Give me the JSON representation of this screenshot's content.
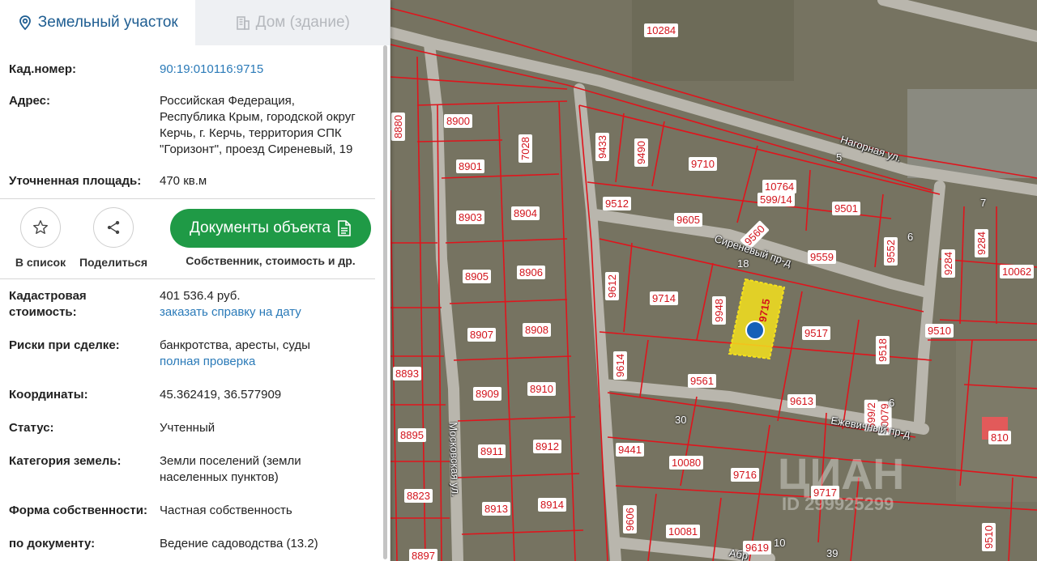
{
  "tabs": [
    {
      "label": "Земельный участок",
      "icon": "map-pin-icon",
      "active": true
    },
    {
      "label": "Дом (здание)",
      "icon": "building-icon",
      "active": false
    }
  ],
  "info_top": [
    {
      "label": "Кад.номер:",
      "value": "90:19:010116:9715",
      "is_link": true
    },
    {
      "label": "Адрес:",
      "value_lines": [
        "Российская Федерация,",
        "Республика Крым, городской округ",
        "Керчь, г. Керчь, территория СПК",
        "\"Горизонт\", проезд Сиреневый, 19"
      ]
    },
    {
      "label": "Уточненная площадь:",
      "value": "470 кв.м"
    }
  ],
  "actions": {
    "favorite_label": "В список",
    "share_label": "Поделиться",
    "documents_button": "Документы объекта",
    "documents_sub": "Собственник, стоимость и др."
  },
  "info_bottom": [
    {
      "label_lines": [
        "Кадастровая",
        "стоимость:"
      ],
      "value": "401 536.4 руб.",
      "link": "заказать справку на дату"
    },
    {
      "label": "Риски при сделке:",
      "value": "банкротства, аресты, суды",
      "link": "полная проверка"
    },
    {
      "label": "Координаты:",
      "value": "45.362419, 36.577909"
    },
    {
      "label": "Статус:",
      "value": "Учтенный"
    },
    {
      "label": "Категория земель:",
      "value_lines": [
        "Земли поселений (земли",
        "населенных пунктов)"
      ]
    },
    {
      "label": "Форма собственности:",
      "value": "Частная собственность"
    },
    {
      "label": "по документу:",
      "value": "Ведение садоводства (13.2)"
    }
  ],
  "map": {
    "plot_labels": [
      "10284",
      "8900",
      "8901",
      "8903",
      "8904",
      "8905",
      "8906",
      "8907",
      "8908",
      "8909",
      "8910",
      "8911",
      "8912",
      "8913",
      "8914",
      "8893",
      "8895",
      "8823",
      "8897",
      "8880",
      "7028",
      "9433",
      "9490",
      "9710",
      "9512",
      "9605",
      "10764",
      "599/14",
      "9501",
      "9552",
      "9284",
      "9284",
      "10062",
      "9560",
      "9559",
      "9612",
      "9714",
      "9948",
      "9715",
      "9517",
      "9518",
      "9510",
      "9614",
      "9561",
      "9613",
      "599/2",
      "10079",
      "810",
      "9441",
      "10080",
      "9716",
      "9717",
      "9606",
      "10081",
      "9619",
      "9510"
    ],
    "streets": [
      "Нагорная ул.",
      "Сиреневый пр-д",
      "Московская ул.",
      "Ежевичный пр-д",
      "Абр"
    ],
    "house_numbers": [
      "5",
      "7",
      "6",
      "18",
      "30",
      "6",
      "10",
      "39"
    ],
    "watermark": "ЦИАН",
    "watermark_id": "ID 299925299",
    "selected_plot_color": "#f5e11d",
    "boundary_color": "#e0141c",
    "pin_color": "#1560b8"
  }
}
